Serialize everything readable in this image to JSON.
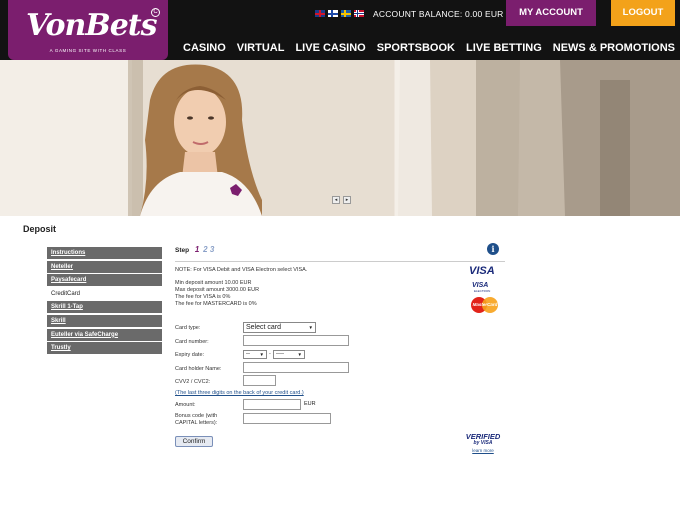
{
  "brand": {
    "name": "VonBets",
    "tagline": "A GAMING SITE WITH CLASS",
    "reg_mark": "C"
  },
  "header": {
    "languages": [
      "en",
      "fi",
      "se",
      "no"
    ],
    "account_balance": "ACCOUNT BALANCE: 0.00 EUR",
    "my_account_label": "MY ACCOUNT",
    "logout_label": "LOGOUT"
  },
  "nav": [
    "CASINO",
    "VIRTUAL",
    "LIVE CASINO",
    "SPORTSBOOK",
    "LIVE BETTING",
    "NEWS & PROMOTIONS"
  ],
  "hero": {
    "prev_label": "◂",
    "next_label": "▸"
  },
  "page_title": "Deposit",
  "sidebar": {
    "items": [
      {
        "label": "Instructions",
        "active": false
      },
      {
        "label": "Neteller",
        "active": false
      },
      {
        "label": "Paysafecard",
        "active": false
      },
      {
        "label": "CreditCard",
        "active": true
      },
      {
        "label": "Skrill 1-Tap",
        "active": false
      },
      {
        "label": "Skrill",
        "active": false
      },
      {
        "label": "Euteller via SafeCharge",
        "active": false
      },
      {
        "label": "Trustly",
        "active": false
      }
    ]
  },
  "steps": {
    "label": "Step",
    "current": "1",
    "rest": "2 3"
  },
  "info_icon_glyph": "i",
  "notes": {
    "visa_note": "NOTE: For VISA Debit and VISA Electron select VISA.",
    "min_deposit": "Min deposit amount 10.00 EUR",
    "max_deposit": "Max deposit amount 3000.00 EUR",
    "fee_visa": "The fee for VISA is 0%",
    "fee_mastercard": "The fee for MASTERCARD is 0%"
  },
  "form": {
    "card_type_label": "Card type:",
    "card_type_value": "Select card",
    "card_number_label": "Card number:",
    "card_number_value": "",
    "expiry_label": "Expiry date:",
    "expiry_month": "--",
    "expiry_separator": "-",
    "expiry_year": "----",
    "holder_label": "Card holder Name:",
    "holder_value": "",
    "cvv_label": "CVV2 / CVC2:",
    "cvv_value": "",
    "cvv_help": "(The last three digits on the back of your credit card.)",
    "amount_label": "Amount:",
    "amount_value": "",
    "amount_unit": "EUR",
    "bonus_label_line1": "Bonus code (with",
    "bonus_label_line2": "CAPITAL letters):",
    "bonus_value": "",
    "confirm_label": "Confirm"
  },
  "card_logos": {
    "visa": "VISA",
    "visa_electron": "VISA",
    "electron": "ELECTRON",
    "mastercard": "MasterCard"
  },
  "verified_by_visa": {
    "line1": "VERIFIED",
    "line2": "by VISA",
    "link": "learn more"
  },
  "colors": {
    "brand_purple": "#7b1e6e",
    "logout_orange": "#f3a21a",
    "header_bg": "#121212",
    "sidebar_bg": "#6a6a6a"
  }
}
